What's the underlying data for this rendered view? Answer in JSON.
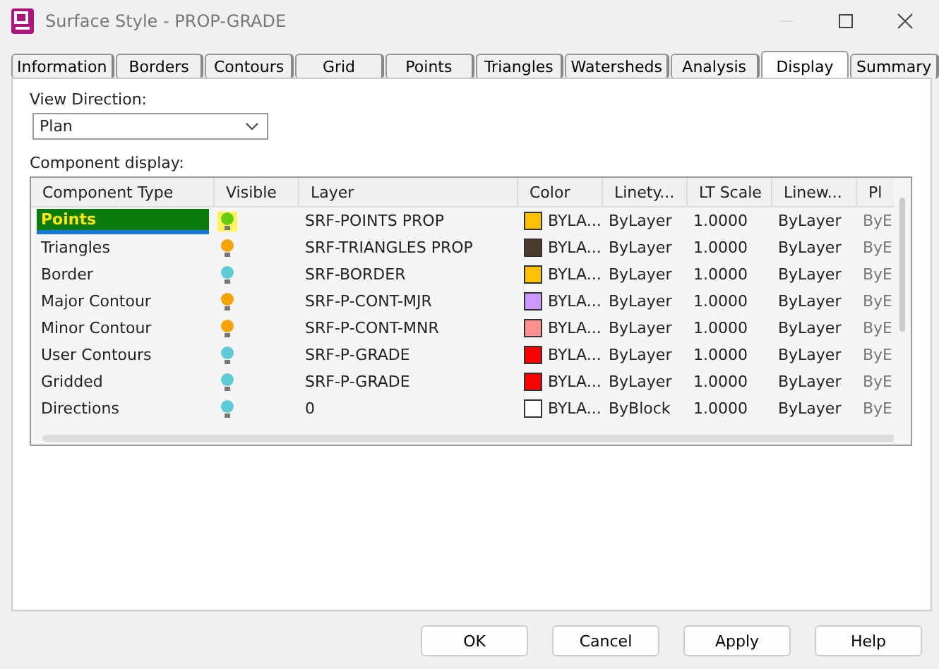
{
  "window": {
    "title": "Surface Style - PROP-GRADE"
  },
  "tabs": [
    {
      "label": "Information",
      "selected": false
    },
    {
      "label": "Borders",
      "selected": false
    },
    {
      "label": "Contours",
      "selected": false
    },
    {
      "label": "Grid",
      "selected": false
    },
    {
      "label": "Points",
      "selected": false
    },
    {
      "label": "Triangles",
      "selected": false
    },
    {
      "label": "Watersheds",
      "selected": false
    },
    {
      "label": "Analysis",
      "selected": false
    },
    {
      "label": "Display",
      "selected": true
    },
    {
      "label": "Summary",
      "selected": false
    }
  ],
  "view_direction": {
    "label": "View Direction:",
    "value": "Plan"
  },
  "component_display": {
    "label": "Component display:",
    "columns": [
      "Component Type",
      "Visible",
      "Layer",
      "Color",
      "Linety...",
      "LT Scale",
      "Linew...",
      "Pl"
    ],
    "rows": [
      {
        "component_type": "Points",
        "visible": {
          "color": "#66cc11"
        },
        "layer": "SRF-POINTS PROP",
        "swatch": {
          "color": "#ffc000"
        },
        "color_name": "BYLA...",
        "linetype": "ByLayer",
        "lt_scale": "1.0000",
        "lineweight": "ByLayer",
        "column_8": "ByE",
        "selected": true
      },
      {
        "component_type": "Triangles",
        "visible": {
          "color": "#f5a300"
        },
        "layer": "SRF-TRIANGLES PROP",
        "swatch": {
          "color": "#4a3a2a"
        },
        "color_name": "BYLA...",
        "linetype": "ByLayer",
        "lt_scale": "1.0000",
        "lineweight": "ByLayer",
        "column_8": "ByE",
        "selected": false
      },
      {
        "component_type": "Border",
        "visible": {
          "color": "#5ccbd6"
        },
        "layer": "SRF-BORDER",
        "swatch": {
          "color": "#ffc000"
        },
        "color_name": "BYLA...",
        "linetype": "ByLayer",
        "lt_scale": "1.0000",
        "lineweight": "ByLayer",
        "column_8": "ByE",
        "selected": false
      },
      {
        "component_type": "Major Contour",
        "visible": {
          "color": "#f5a300"
        },
        "layer": "SRF-P-CONT-MJR",
        "swatch": {
          "color": "#cc99ff"
        },
        "color_name": "BYLA...",
        "linetype": "ByLayer",
        "lt_scale": "1.0000",
        "lineweight": "ByLayer",
        "column_8": "ByE",
        "selected": false
      },
      {
        "component_type": "Minor Contour",
        "visible": {
          "color": "#f5a300"
        },
        "layer": "SRF-P-CONT-MNR",
        "swatch": {
          "color": "#ff9090"
        },
        "color_name": "BYLA...",
        "linetype": "ByLayer",
        "lt_scale": "1.0000",
        "lineweight": "ByLayer",
        "column_8": "ByE",
        "selected": false
      },
      {
        "component_type": "User Contours",
        "visible": {
          "color": "#5ccbd6"
        },
        "layer": "SRF-P-GRADE",
        "swatch": {
          "color": "#ff0000"
        },
        "color_name": "BYLA...",
        "linetype": "ByLayer",
        "lt_scale": "1.0000",
        "lineweight": "ByLayer",
        "column_8": "ByE",
        "selected": false
      },
      {
        "component_type": "Gridded",
        "visible": {
          "color": "#5ccbd6"
        },
        "layer": "SRF-P-GRADE",
        "swatch": {
          "color": "#ff0000"
        },
        "color_name": "BYLA...",
        "linetype": "ByLayer",
        "lt_scale": "1.0000",
        "lineweight": "ByLayer",
        "column_8": "ByE",
        "selected": false
      },
      {
        "component_type": "Directions",
        "visible": {
          "color": "#5ccbd6"
        },
        "layer": "0",
        "swatch": {
          "color": "#ffffff"
        },
        "color_name": "BYLA...",
        "linetype": "ByBlock",
        "lt_scale": "1.0000",
        "lineweight": "ByLayer",
        "column_8": "ByE",
        "selected": false
      }
    ]
  },
  "buttons": [
    "OK",
    "Cancel",
    "Apply",
    "Help"
  ]
}
